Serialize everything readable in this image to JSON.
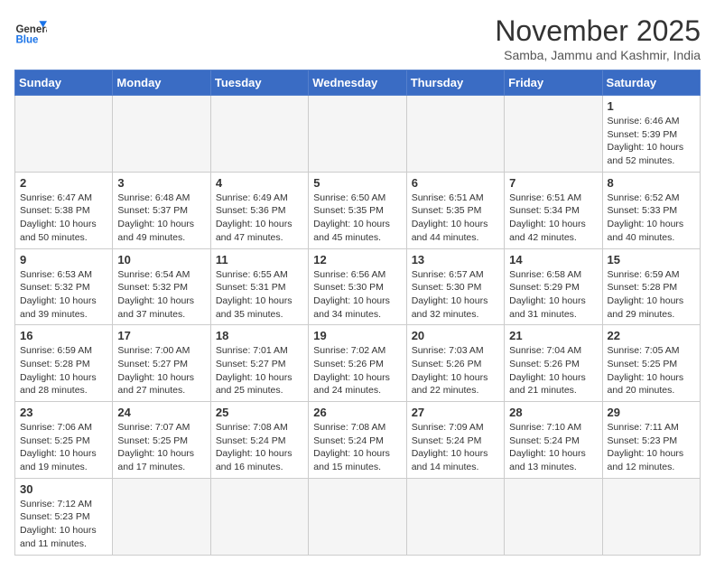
{
  "logo": {
    "general": "General",
    "blue": "Blue"
  },
  "header": {
    "month_year": "November 2025",
    "location": "Samba, Jammu and Kashmir, India"
  },
  "weekdays": [
    "Sunday",
    "Monday",
    "Tuesday",
    "Wednesday",
    "Thursday",
    "Friday",
    "Saturday"
  ],
  "weeks": [
    [
      null,
      null,
      null,
      null,
      null,
      null,
      {
        "day": 1,
        "sunrise": "6:46 AM",
        "sunset": "5:39 PM",
        "daylight": "10 hours and 52 minutes."
      }
    ],
    [
      {
        "day": 2,
        "sunrise": "6:47 AM",
        "sunset": "5:38 PM",
        "daylight": "10 hours and 50 minutes."
      },
      {
        "day": 3,
        "sunrise": "6:48 AM",
        "sunset": "5:37 PM",
        "daylight": "10 hours and 49 minutes."
      },
      {
        "day": 4,
        "sunrise": "6:49 AM",
        "sunset": "5:36 PM",
        "daylight": "10 hours and 47 minutes."
      },
      {
        "day": 5,
        "sunrise": "6:50 AM",
        "sunset": "5:35 PM",
        "daylight": "10 hours and 45 minutes."
      },
      {
        "day": 6,
        "sunrise": "6:51 AM",
        "sunset": "5:35 PM",
        "daylight": "10 hours and 44 minutes."
      },
      {
        "day": 7,
        "sunrise": "6:51 AM",
        "sunset": "5:34 PM",
        "daylight": "10 hours and 42 minutes."
      },
      {
        "day": 8,
        "sunrise": "6:52 AM",
        "sunset": "5:33 PM",
        "daylight": "10 hours and 40 minutes."
      }
    ],
    [
      {
        "day": 9,
        "sunrise": "6:53 AM",
        "sunset": "5:32 PM",
        "daylight": "10 hours and 39 minutes."
      },
      {
        "day": 10,
        "sunrise": "6:54 AM",
        "sunset": "5:32 PM",
        "daylight": "10 hours and 37 minutes."
      },
      {
        "day": 11,
        "sunrise": "6:55 AM",
        "sunset": "5:31 PM",
        "daylight": "10 hours and 35 minutes."
      },
      {
        "day": 12,
        "sunrise": "6:56 AM",
        "sunset": "5:30 PM",
        "daylight": "10 hours and 34 minutes."
      },
      {
        "day": 13,
        "sunrise": "6:57 AM",
        "sunset": "5:30 PM",
        "daylight": "10 hours and 32 minutes."
      },
      {
        "day": 14,
        "sunrise": "6:58 AM",
        "sunset": "5:29 PM",
        "daylight": "10 hours and 31 minutes."
      },
      {
        "day": 15,
        "sunrise": "6:59 AM",
        "sunset": "5:28 PM",
        "daylight": "10 hours and 29 minutes."
      }
    ],
    [
      {
        "day": 16,
        "sunrise": "6:59 AM",
        "sunset": "5:28 PM",
        "daylight": "10 hours and 28 minutes."
      },
      {
        "day": 17,
        "sunrise": "7:00 AM",
        "sunset": "5:27 PM",
        "daylight": "10 hours and 27 minutes."
      },
      {
        "day": 18,
        "sunrise": "7:01 AM",
        "sunset": "5:27 PM",
        "daylight": "10 hours and 25 minutes."
      },
      {
        "day": 19,
        "sunrise": "7:02 AM",
        "sunset": "5:26 PM",
        "daylight": "10 hours and 24 minutes."
      },
      {
        "day": 20,
        "sunrise": "7:03 AM",
        "sunset": "5:26 PM",
        "daylight": "10 hours and 22 minutes."
      },
      {
        "day": 21,
        "sunrise": "7:04 AM",
        "sunset": "5:26 PM",
        "daylight": "10 hours and 21 minutes."
      },
      {
        "day": 22,
        "sunrise": "7:05 AM",
        "sunset": "5:25 PM",
        "daylight": "10 hours and 20 minutes."
      }
    ],
    [
      {
        "day": 23,
        "sunrise": "7:06 AM",
        "sunset": "5:25 PM",
        "daylight": "10 hours and 19 minutes."
      },
      {
        "day": 24,
        "sunrise": "7:07 AM",
        "sunset": "5:25 PM",
        "daylight": "10 hours and 17 minutes."
      },
      {
        "day": 25,
        "sunrise": "7:08 AM",
        "sunset": "5:24 PM",
        "daylight": "10 hours and 16 minutes."
      },
      {
        "day": 26,
        "sunrise": "7:08 AM",
        "sunset": "5:24 PM",
        "daylight": "10 hours and 15 minutes."
      },
      {
        "day": 27,
        "sunrise": "7:09 AM",
        "sunset": "5:24 PM",
        "daylight": "10 hours and 14 minutes."
      },
      {
        "day": 28,
        "sunrise": "7:10 AM",
        "sunset": "5:24 PM",
        "daylight": "10 hours and 13 minutes."
      },
      {
        "day": 29,
        "sunrise": "7:11 AM",
        "sunset": "5:23 PM",
        "daylight": "10 hours and 12 minutes."
      }
    ],
    [
      {
        "day": 30,
        "sunrise": "7:12 AM",
        "sunset": "5:23 PM",
        "daylight": "10 hours and 11 minutes."
      },
      null,
      null,
      null,
      null,
      null,
      null
    ]
  ],
  "labels": {
    "sunrise": "Sunrise:",
    "sunset": "Sunset:",
    "daylight": "Daylight:"
  }
}
